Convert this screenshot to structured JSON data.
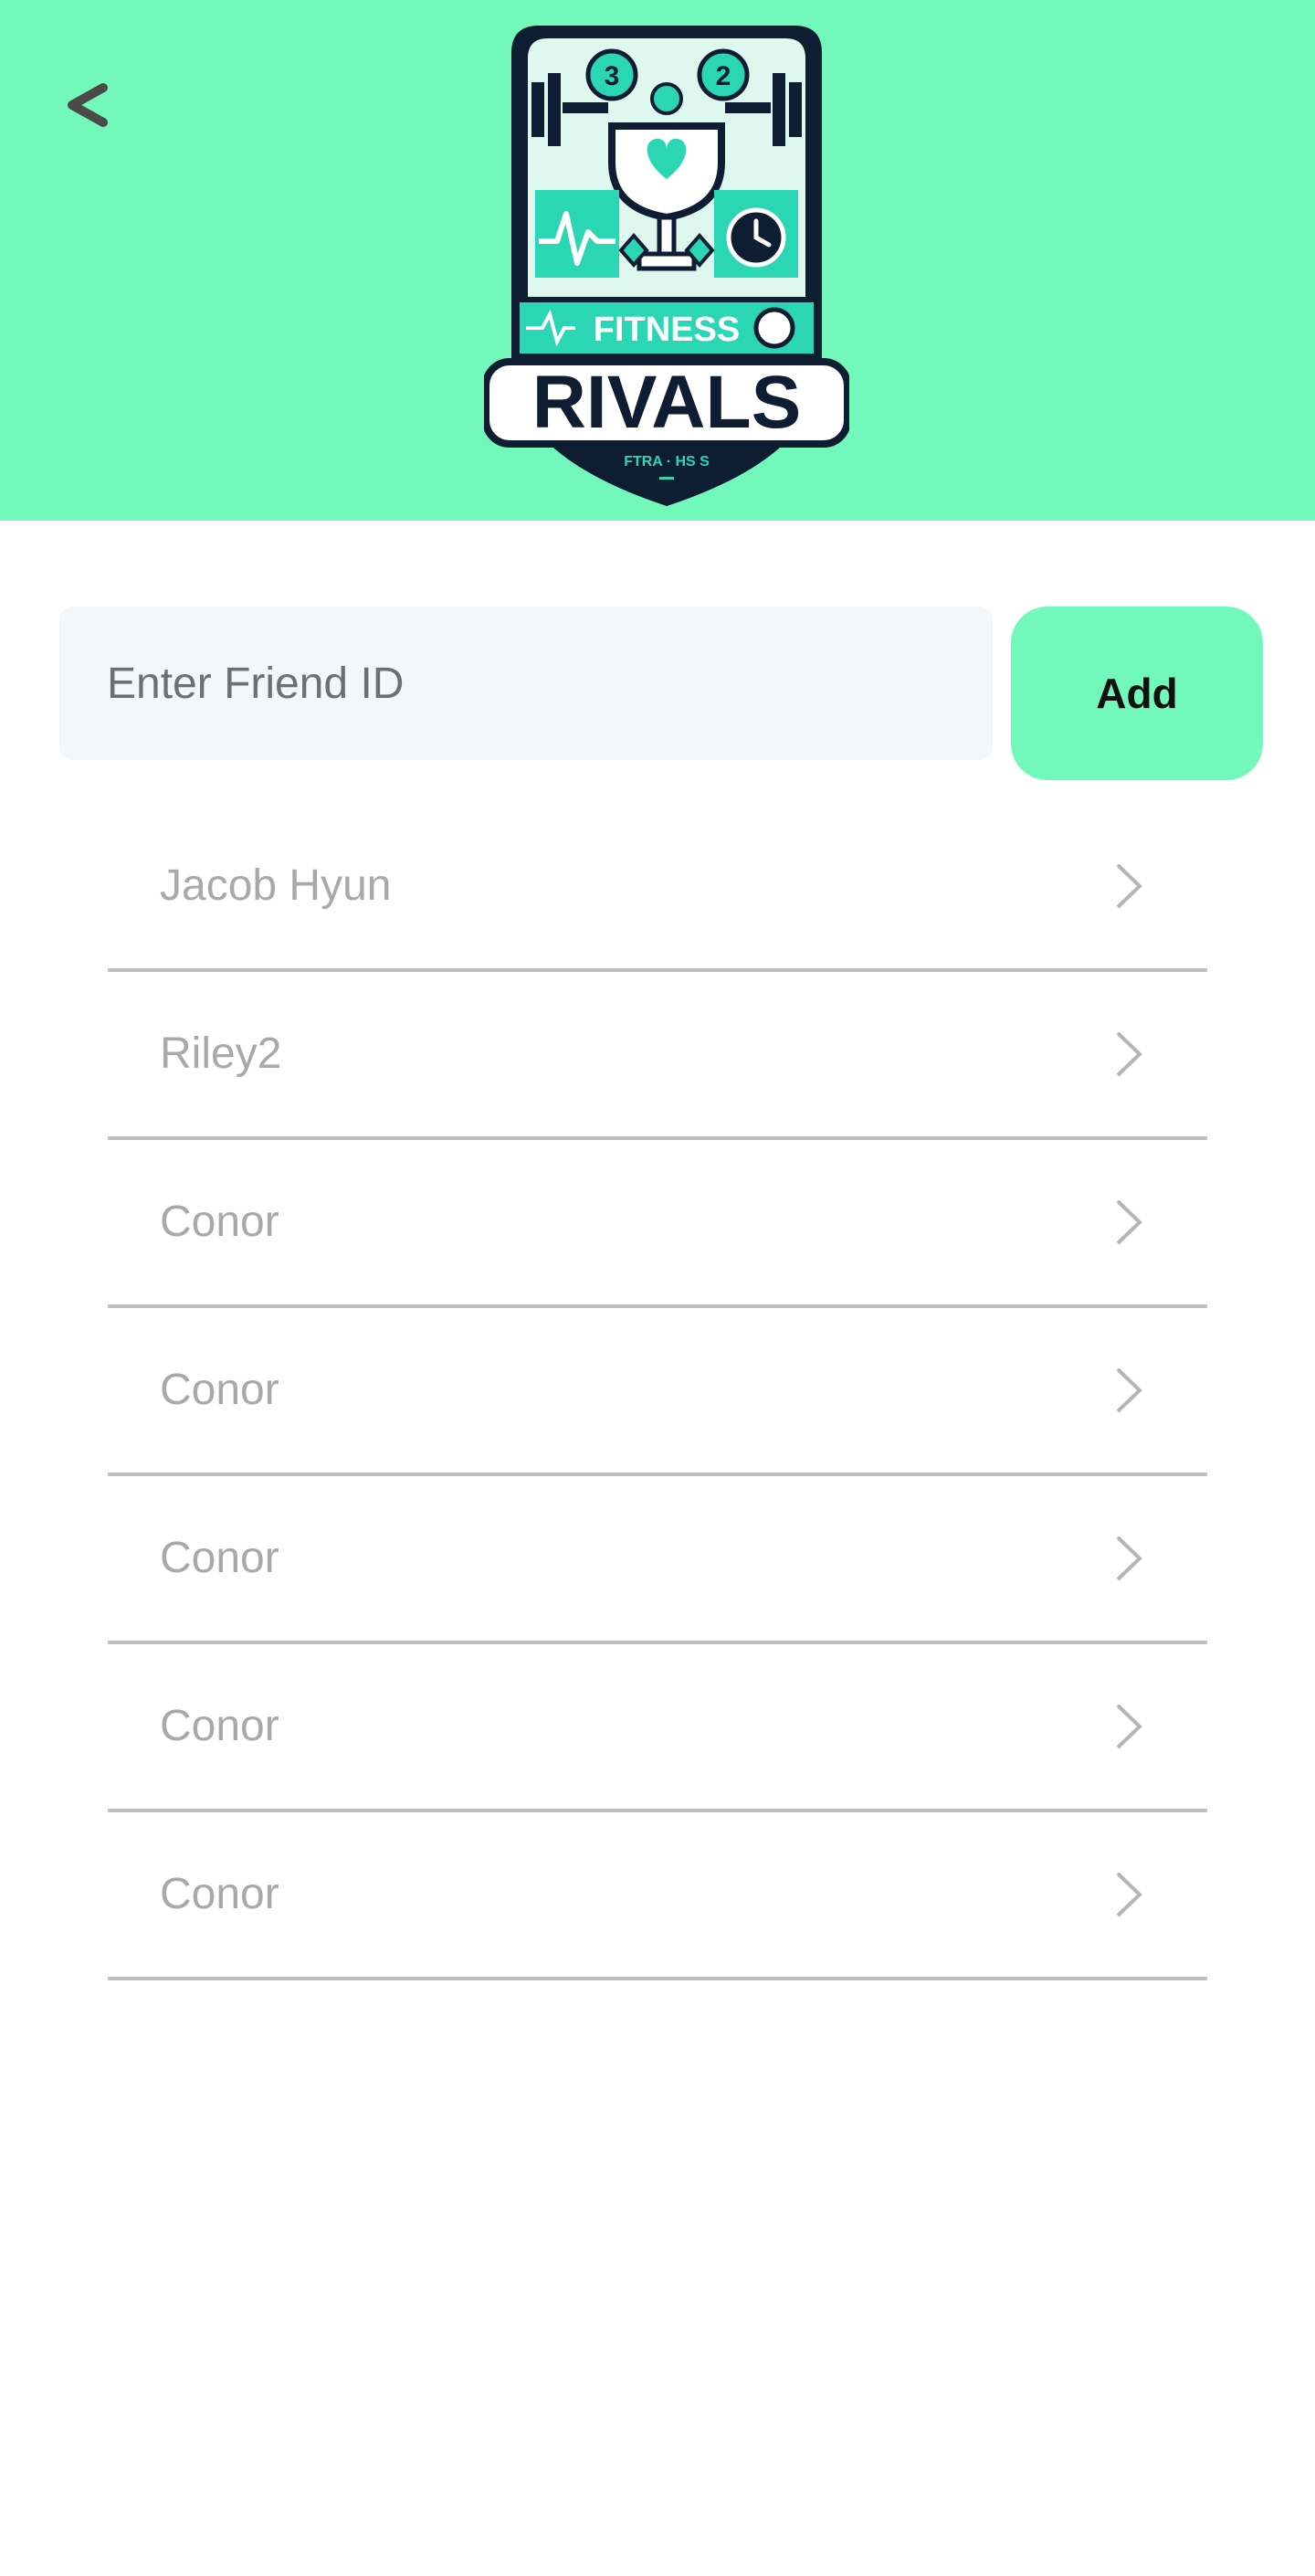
{
  "header": {
    "back_label": "<",
    "logo": {
      "text_primary": "FITNESS",
      "text_secondary": "RIVALS",
      "text_small": "FTRA · HS S",
      "badge_left": "3",
      "badge_right": "2",
      "icon": "trophy-heart-logo"
    },
    "background_color": "#73f8bb"
  },
  "add_friend": {
    "placeholder": "Enter Friend ID",
    "value": "",
    "button_label": "Add"
  },
  "friends": [
    {
      "name": "Jacob Hyun",
      "icon": "chevron-right-icon"
    },
    {
      "name": "Riley2",
      "icon": "chevron-right-icon"
    },
    {
      "name": "Conor",
      "icon": "chevron-right-icon"
    },
    {
      "name": "Conor",
      "icon": "chevron-right-icon"
    },
    {
      "name": "Conor",
      "icon": "chevron-right-icon"
    },
    {
      "name": "Conor",
      "icon": "chevron-right-icon"
    },
    {
      "name": "Conor",
      "icon": "chevron-right-icon"
    }
  ],
  "colors": {
    "accent": "#73f8bb",
    "logo_dark": "#0f1d33",
    "logo_teal": "#2bd6b4",
    "list_text": "#a9a9a9",
    "divider": "#bfbfbf"
  }
}
